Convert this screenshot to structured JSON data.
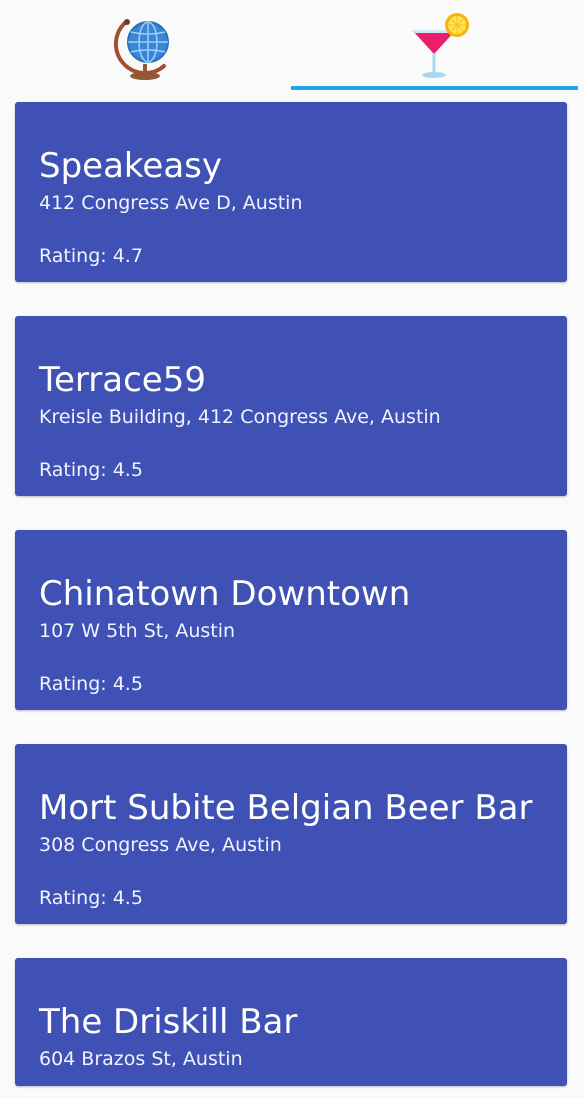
{
  "tabs": [
    {
      "icon": "globe-icon",
      "selected": false
    },
    {
      "icon": "cocktail-icon",
      "selected": true
    }
  ],
  "colors": {
    "card_background": "#3f51b5",
    "tab_indicator": "#1ea7e6",
    "page_background": "#fafafa"
  },
  "places": [
    {
      "name": "Speakeasy",
      "address": "412 Congress Ave D, Austin",
      "rating": "Rating: 4.7"
    },
    {
      "name": "Terrace59",
      "address": "Kreisle Building, 412 Congress Ave, Austin",
      "rating": "Rating: 4.5"
    },
    {
      "name": "Chinatown Downtown",
      "address": "107 W 5th St, Austin",
      "rating": "Rating: 4.5"
    },
    {
      "name": "Mort Subite Belgian Beer Bar",
      "address": "308 Congress Ave, Austin",
      "rating": "Rating: 4.5"
    },
    {
      "name": "The Driskill Bar",
      "address": "604 Brazos St, Austin",
      "rating": ""
    }
  ]
}
